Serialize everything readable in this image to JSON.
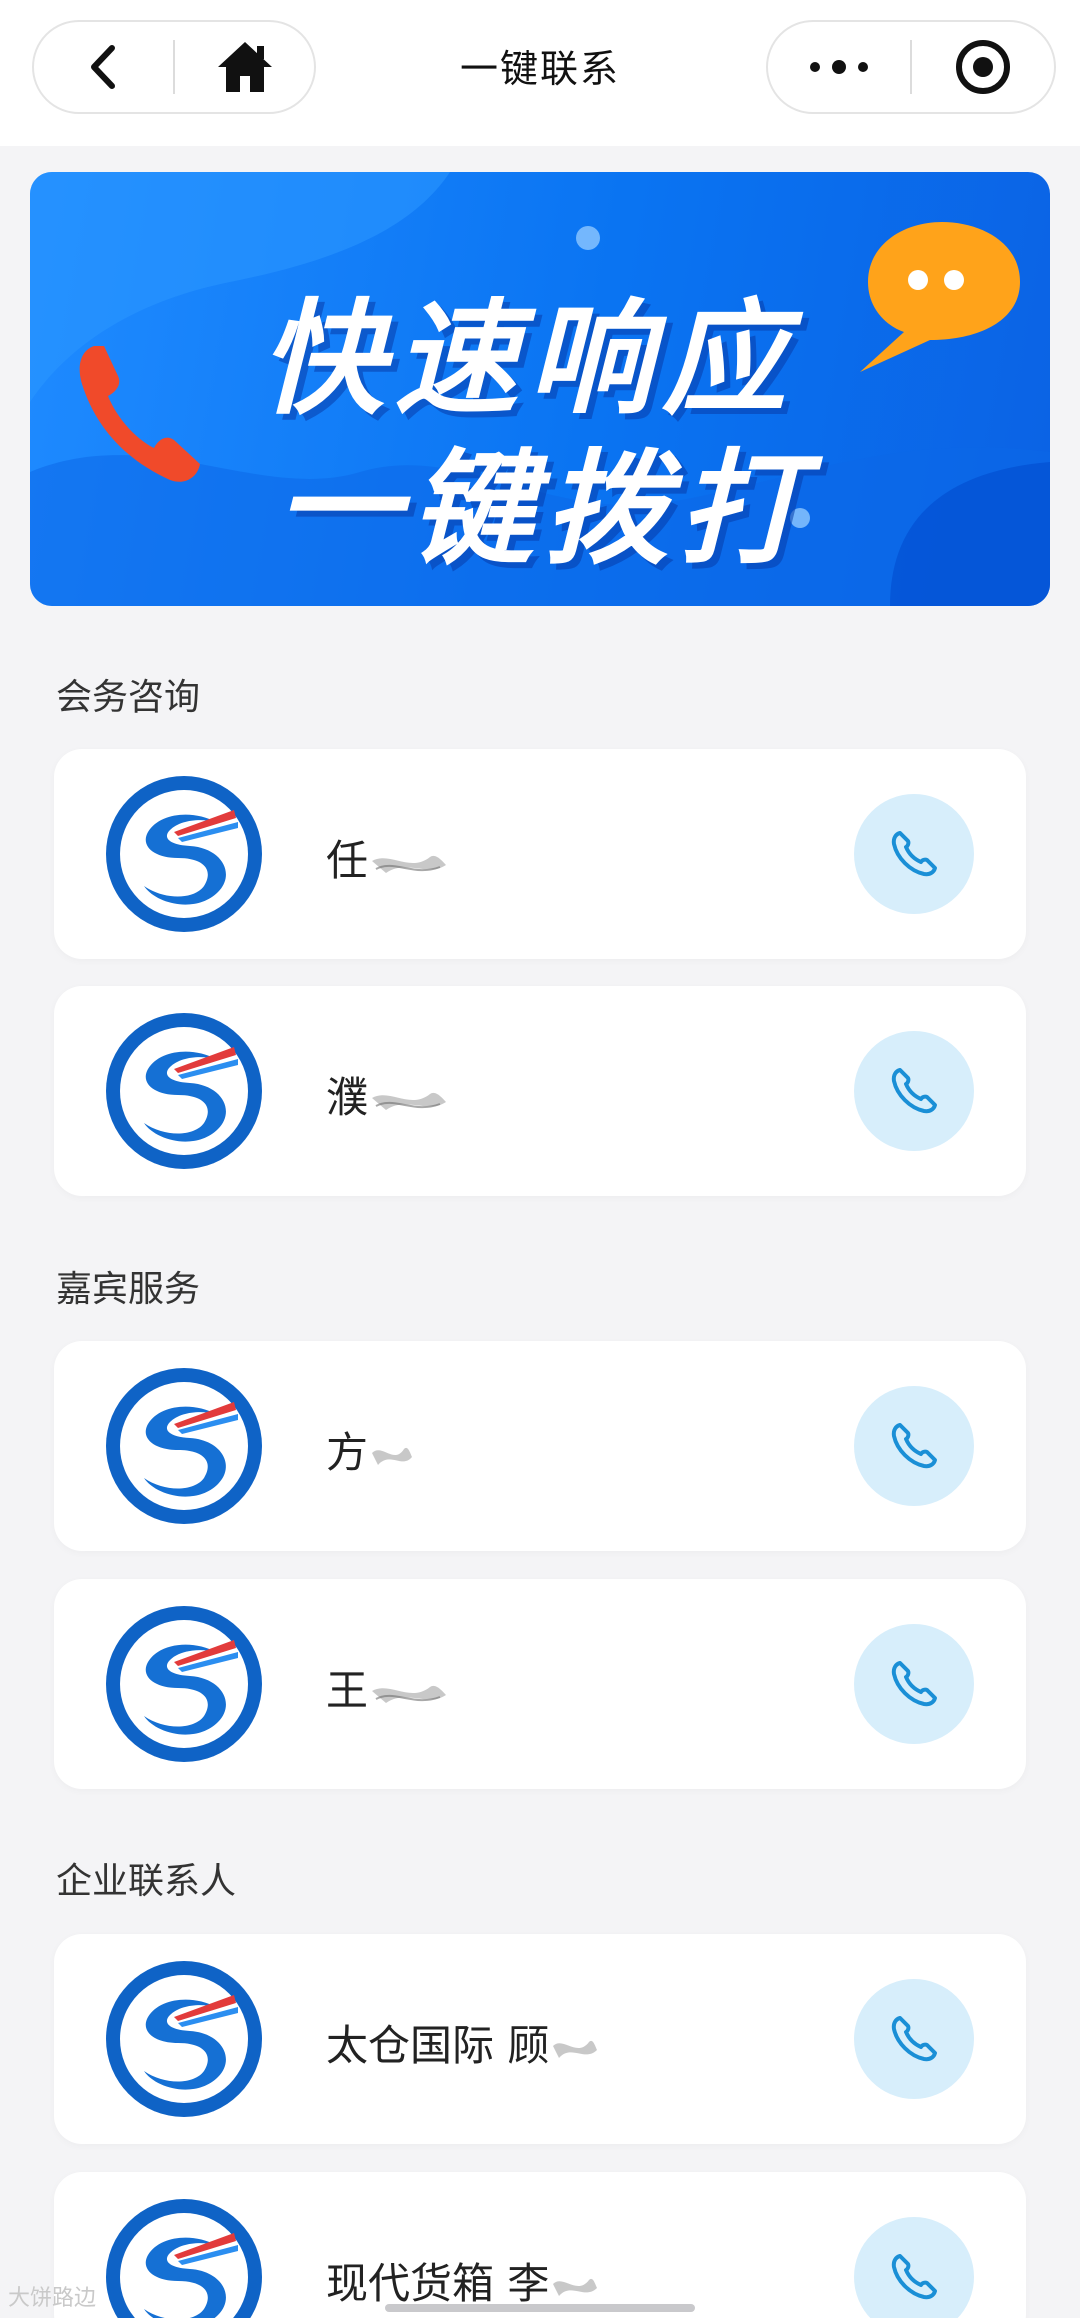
{
  "header": {
    "title": "一键联系",
    "back_icon": "back-chevron-icon",
    "home_icon": "home-icon",
    "more_icon": "more-dots-icon",
    "close_icon": "target-circle-icon"
  },
  "banner": {
    "line1": "快速响应",
    "line2": "一键拨打",
    "phone_icon": "phone-handset-icon",
    "chat_icon": "chat-bubble-icon"
  },
  "sections": [
    {
      "title": "会务咨询",
      "contacts": [
        {
          "name": "任"
        },
        {
          "name": "濮"
        }
      ]
    },
    {
      "title": "嘉宾服务",
      "contacts": [
        {
          "name": "方"
        },
        {
          "name": "王"
        }
      ]
    },
    {
      "title": "企业联系人",
      "contacts": [
        {
          "name": "太仓国际 顾"
        },
        {
          "name": "现代货箱 李"
        }
      ]
    }
  ],
  "watermark": "大饼路边",
  "colors": {
    "accent": "#0a74f2",
    "call_button_bg": "#d7eefb",
    "call_icon": "#1a8fd6",
    "chat_bubble": "#ffa31a",
    "phone_red": "#f04a2a"
  }
}
